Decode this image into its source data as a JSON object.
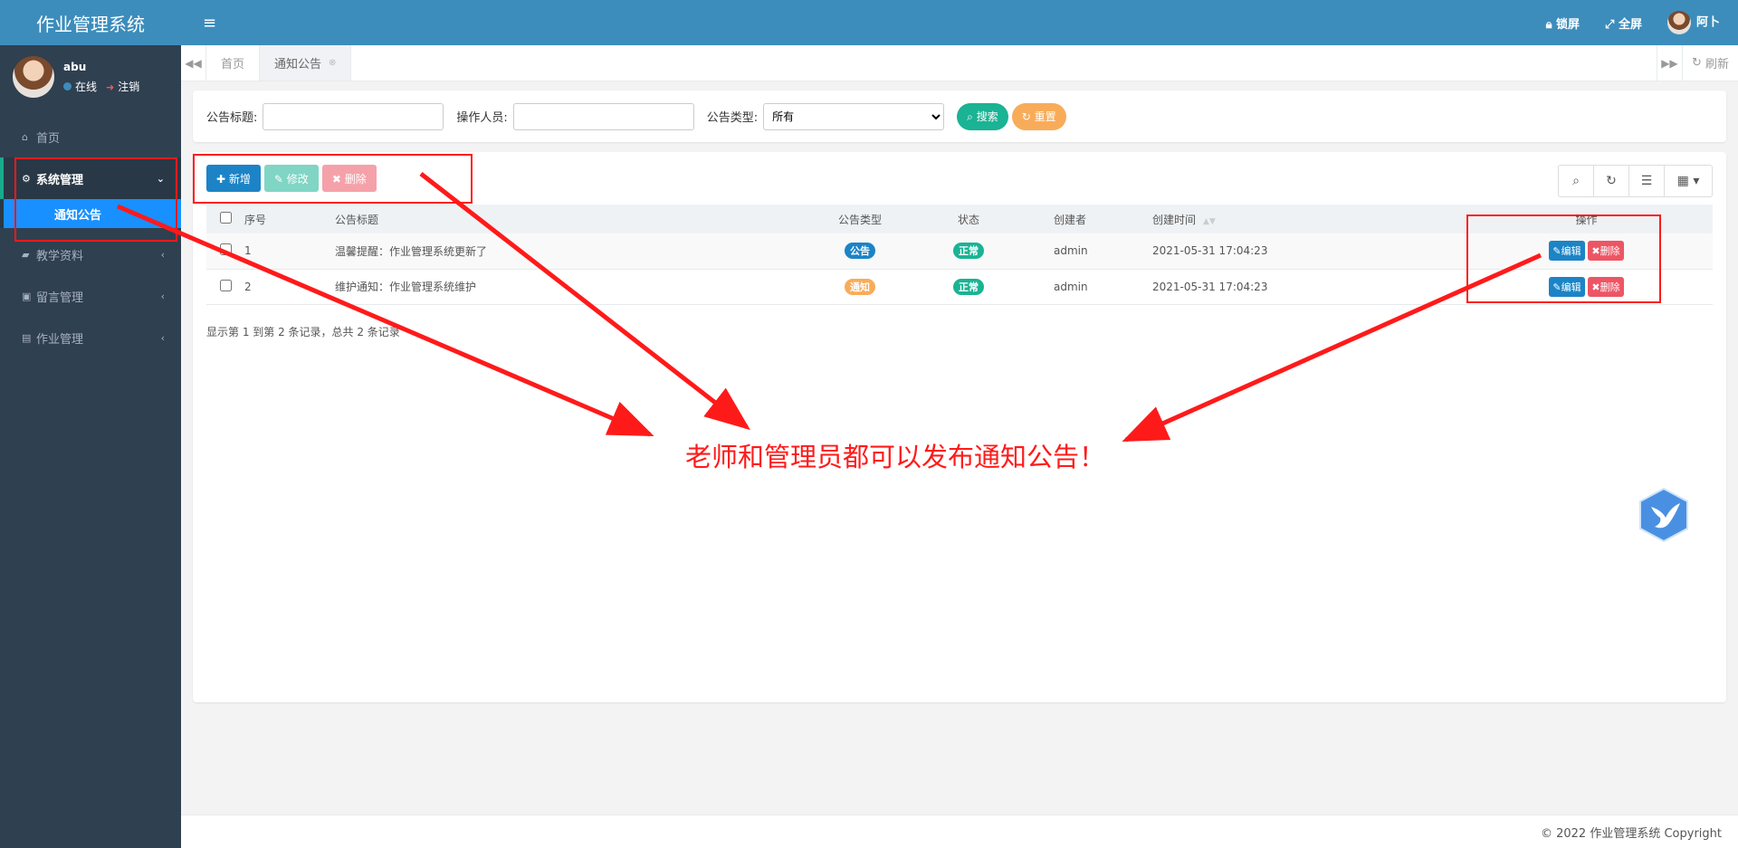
{
  "sidebar": {
    "brand": "作业管理系统",
    "user": {
      "name": "abu",
      "status": "在线",
      "logout": "注销"
    },
    "menu": [
      {
        "label": "首页",
        "icon": "home-icon"
      },
      {
        "label": "系统管理",
        "icon": "gear-icon",
        "expanded": true,
        "children": [
          {
            "label": "通知公告"
          }
        ]
      },
      {
        "label": "教学资料",
        "icon": "folder-icon"
      },
      {
        "label": "留言管理",
        "icon": "inbox-icon"
      },
      {
        "label": "作业管理",
        "icon": "id-card-icon"
      }
    ]
  },
  "topnav": {
    "lock": "锁屏",
    "fullscreen": "全屏",
    "user": "阿卜"
  },
  "tabs": {
    "items": [
      "首页",
      "通知公告"
    ],
    "active": "通知公告",
    "refresh": "刷新"
  },
  "search": {
    "title_label": "公告标题:",
    "operator_label": "操作人员:",
    "type_label": "公告类型:",
    "type_value": "所有",
    "search_btn": "搜索",
    "reset_btn": "重置"
  },
  "toolbar": {
    "add": "新增",
    "edit": "修改",
    "delete": "删除"
  },
  "table": {
    "headers": [
      "序号",
      "公告标题",
      "公告类型",
      "状态",
      "创建者",
      "创建时间",
      "操作"
    ],
    "rows": [
      {
        "id": "1",
        "title": "温馨提醒：作业管理系统更新了",
        "type": "公告",
        "status": "正常",
        "creator": "admin",
        "time": "2021-05-31 17:04:23"
      },
      {
        "id": "2",
        "title": "维护通知：作业管理系统维护",
        "type": "通知",
        "status": "正常",
        "creator": "admin",
        "time": "2021-05-31 17:04:23"
      }
    ],
    "row_edit": "编辑",
    "row_delete": "删除",
    "summary": "显示第 1 到第 2 条记录，总共 2 条记录"
  },
  "annotation": "老师和管理员都可以发布通知公告！",
  "footer": "© 2022 作业管理系统 Copyright",
  "colors": {
    "primary": "#3c8dbc",
    "sidebar": "#2f4050",
    "green": "#1ab394",
    "orange": "#f8ac59",
    "red": "#ed5565",
    "annotation": "#ff1a1a"
  }
}
